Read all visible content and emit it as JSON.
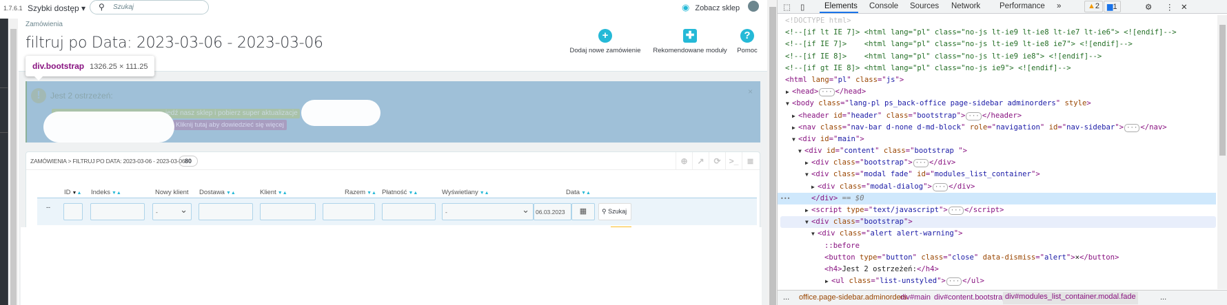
{
  "topbar": {
    "version": "1.7.6.1",
    "quick_access": "Szybki dostęp ▾",
    "search_placeholder": "Szukaj",
    "view_shop": "Zobacz sklep"
  },
  "header": {
    "breadcrumb": "Zamówienia",
    "title": "filtruj po Data: 2023-03-06 - 2023-03-06",
    "toolbar": [
      {
        "label": "Dodaj nowe zamówienie",
        "icon": "plus-circle-icon"
      },
      {
        "label": "Rekomendowane moduły",
        "icon": "puzzle-icon"
      },
      {
        "label": "Pomoc",
        "icon": "question-circle-icon"
      }
    ]
  },
  "inspect_tooltip": {
    "selector": "div.bootstrap",
    "size": "1326.25 × 111.25"
  },
  "alert": {
    "heading": "Jest 2 ostrzeżeń:",
    "line1": "iedź nasz sklep i pobierz super aktualizacje",
    "line2": "Kliknij tutaj aby dowiedzieć się więcej",
    "close": "×"
  },
  "panel": {
    "heading": "ZAMÓWIENIA > FILTRUJ PO DATA: 2023-03-06 - 2023-03-06",
    "count": "80",
    "columns": [
      "ID",
      "Indeks",
      "Nowy klient",
      "Dostawa",
      "Klient",
      "Razem",
      "Płatność",
      "Wyświetlany",
      "Data"
    ],
    "filters": {
      "row_marker": "--",
      "new_client": "-",
      "displayed": "-",
      "date_from": "06.03.2023",
      "search_button": "Szukaj"
    }
  },
  "devtools": {
    "tabs": [
      "Elements",
      "Console",
      "Sources",
      "Network",
      "Performance",
      "»"
    ],
    "warnings": "2",
    "messages": "1",
    "lines": [
      [
        [
          "<!DOCTYPE html>",
          "dt"
        ]
      ],
      [
        [
          "<!--[if lt IE 7]> <html lang=\"pl\" class=\"no-js lt-ie9 lt-ie8 lt-ie7 lt-ie6\"> <![endif]-->",
          "cm"
        ]
      ],
      [
        [
          "<!--[if IE 7]>    <html lang=\"pl\" class=\"no-js lt-ie9 lt-ie8 ie7\"> <![endif]-->",
          "cm"
        ]
      ],
      [
        [
          "<!--[if IE 8]>    <html lang=\"pl\" class=\"no-js lt-ie9 ie8\"> <![endif]-->",
          "cm"
        ]
      ],
      [
        [
          "<!--[if gt IE 8]> <html lang=\"pl\" class=\"no-js ie9\"> <![endif]-->",
          "cm"
        ]
      ],
      [
        [
          "<html ",
          "tag"
        ],
        [
          "lang",
          "an"
        ],
        [
          "=\"",
          "tag"
        ],
        [
          "pl",
          "av"
        ],
        [
          "\" ",
          "tag"
        ],
        [
          "class",
          "an"
        ],
        [
          "=\"",
          "tag"
        ],
        [
          "js",
          "av"
        ],
        [
          "\">",
          "tag"
        ]
      ],
      [
        [
          "<head>",
          "tag"
        ],
        [
          "···",
          "el"
        ],
        [
          "</head>",
          "tag"
        ]
      ],
      [
        [
          "<body ",
          "tag"
        ],
        [
          "class",
          "an"
        ],
        [
          "=\"",
          "tag"
        ],
        [
          "lang-pl ps_back-office page-sidebar adminorders",
          "av"
        ],
        [
          "\" ",
          "tag"
        ],
        [
          "style",
          "an"
        ],
        [
          ">",
          "tag"
        ]
      ],
      [
        [
          "<header ",
          "tag"
        ],
        [
          "id",
          "an"
        ],
        [
          "=\"",
          "tag"
        ],
        [
          "header",
          "av"
        ],
        [
          "\" ",
          "tag"
        ],
        [
          "class",
          "an"
        ],
        [
          "=\"",
          "tag"
        ],
        [
          "bootstrap",
          "av"
        ],
        [
          "\">",
          "tag"
        ],
        [
          "···",
          "el"
        ],
        [
          "</header>",
          "tag"
        ]
      ],
      [
        [
          "<nav ",
          "tag"
        ],
        [
          "class",
          "an"
        ],
        [
          "=\"",
          "tag"
        ],
        [
          "nav-bar d-none d-md-block",
          "av"
        ],
        [
          "\" ",
          "tag"
        ],
        [
          "role",
          "an"
        ],
        [
          "=\"",
          "tag"
        ],
        [
          "navigation",
          "av"
        ],
        [
          "\" ",
          "tag"
        ],
        [
          "id",
          "an"
        ],
        [
          "=\"",
          "tag"
        ],
        [
          "nav-sidebar",
          "av"
        ],
        [
          "\">",
          "tag"
        ],
        [
          "···",
          "el"
        ],
        [
          "</nav>",
          "tag"
        ]
      ],
      [
        [
          "<div ",
          "tag"
        ],
        [
          "id",
          "an"
        ],
        [
          "=\"",
          "tag"
        ],
        [
          "main",
          "av"
        ],
        [
          "\">",
          "tag"
        ]
      ],
      [
        [
          "<div ",
          "tag"
        ],
        [
          "id",
          "an"
        ],
        [
          "=\"",
          "tag"
        ],
        [
          "content",
          "av"
        ],
        [
          "\" ",
          "tag"
        ],
        [
          "class",
          "an"
        ],
        [
          "=\"",
          "tag"
        ],
        [
          "bootstrap ",
          "av"
        ],
        [
          "\">",
          "tag"
        ]
      ],
      [
        [
          "<div ",
          "tag"
        ],
        [
          "class",
          "an"
        ],
        [
          "=\"",
          "tag"
        ],
        [
          "bootstrap",
          "av"
        ],
        [
          "\">",
          "tag"
        ],
        [
          "···",
          "el"
        ],
        [
          "</div>",
          "tag"
        ]
      ],
      [
        [
          "<div ",
          "tag"
        ],
        [
          "class",
          "an"
        ],
        [
          "=\"",
          "tag"
        ],
        [
          "modal fade",
          "av"
        ],
        [
          "\" ",
          "tag"
        ],
        [
          "id",
          "an"
        ],
        [
          "=\"",
          "tag"
        ],
        [
          "modules_list_container",
          "av"
        ],
        [
          "\">",
          "tag"
        ]
      ],
      [
        [
          "<div ",
          "tag"
        ],
        [
          "class",
          "an"
        ],
        [
          "=\"",
          "tag"
        ],
        [
          "modal-dialog",
          "av"
        ],
        [
          "\">",
          "tag"
        ],
        [
          "···",
          "el"
        ],
        [
          "</div>",
          "tag"
        ]
      ],
      [
        [
          "</div>",
          "tag"
        ],
        [
          " == $0",
          "eq"
        ]
      ],
      [
        [
          "<script ",
          "tag"
        ],
        [
          "type",
          "an"
        ],
        [
          "=\"",
          "tag"
        ],
        [
          "text/javascript",
          "av"
        ],
        [
          "\">",
          "tag"
        ],
        [
          "···",
          "el"
        ],
        [
          "</script>",
          "tag"
        ]
      ],
      [
        [
          "<div ",
          "tag"
        ],
        [
          "class",
          "an"
        ],
        [
          "=\"",
          "tag"
        ],
        [
          "bootstrap",
          "av"
        ],
        [
          "\">",
          "tag"
        ]
      ],
      [
        [
          "<div ",
          "tag"
        ],
        [
          "class",
          "an"
        ],
        [
          "=\"",
          "tag"
        ],
        [
          "alert alert-warning",
          "av"
        ],
        [
          "\">",
          "tag"
        ]
      ],
      [
        [
          "::before",
          "ps"
        ]
      ],
      [
        [
          "<button ",
          "tag"
        ],
        [
          "type",
          "an"
        ],
        [
          "=\"",
          "tag"
        ],
        [
          "button",
          "av"
        ],
        [
          "\" ",
          "tag"
        ],
        [
          "class",
          "an"
        ],
        [
          "=\"",
          "tag"
        ],
        [
          "close",
          "av"
        ],
        [
          "\" ",
          "tag"
        ],
        [
          "data-dismiss",
          "an"
        ],
        [
          "=\"",
          "tag"
        ],
        [
          "alert",
          "av"
        ],
        [
          "\">",
          "tag"
        ],
        [
          "×",
          "tx"
        ],
        [
          "</button>",
          "tag"
        ]
      ],
      [
        [
          "<h4>",
          "tag"
        ],
        [
          "Jest 2 ostrzeżeń:",
          "tx"
        ],
        [
          "</h4>",
          "tag"
        ]
      ],
      [
        [
          "<ul ",
          "tag"
        ],
        [
          "class",
          "an"
        ],
        [
          "=\"",
          "tag"
        ],
        [
          "list-unstyled",
          "av"
        ],
        [
          "\">",
          "tag"
        ],
        [
          "···",
          "el"
        ],
        [
          "</ul>",
          "tag"
        ]
      ]
    ],
    "breadcrumbs": [
      "...",
      "office.page-sidebar.adminorders",
      "div#main",
      "div#content.bootstrap.",
      "div#modules_list_container.modal.fade",
      "..."
    ]
  }
}
